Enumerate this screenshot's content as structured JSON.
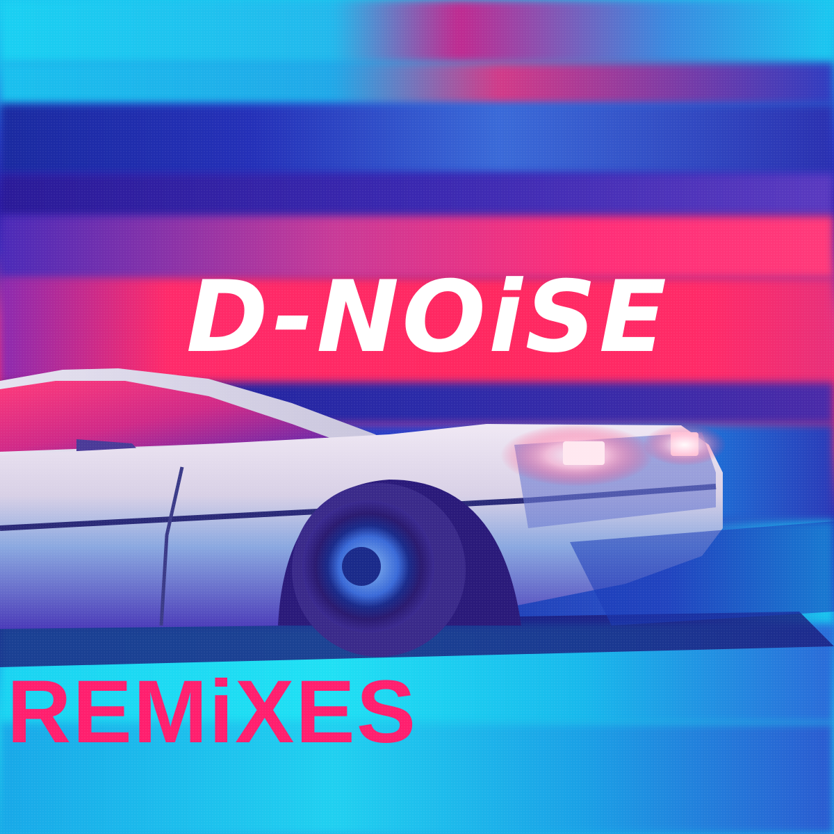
{
  "cover": {
    "artist": "D-NOiSE",
    "subtitle": "REMiXES",
    "colors": {
      "cyan": "#1ec8f0",
      "blue": "#2a2ab0",
      "magenta": "#ff2a6a",
      "title_white": "#ffffff",
      "subtitle_pink": "#ff1f6e"
    },
    "scene": "car-illustration"
  }
}
